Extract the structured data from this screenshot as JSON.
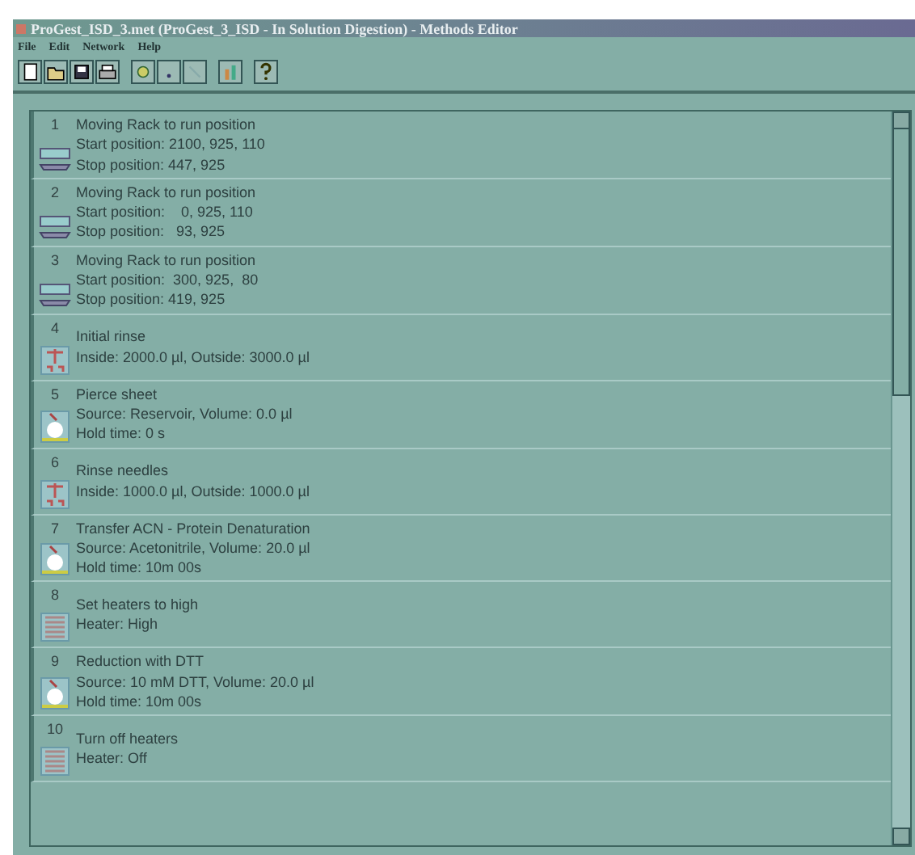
{
  "window": {
    "title": "ProGest_ISD_3.met (ProGest_3_ISD - In Solution Digestion) - Methods Editor"
  },
  "menu": [
    "File",
    "Edit",
    "Network",
    "Help"
  ],
  "steps": [
    {
      "number": "1",
      "kind": "rack",
      "lines": [
        "Moving Rack to run position",
        "Start position: 2100, 925, 110",
        "Stop position: 447, 925"
      ]
    },
    {
      "number": "2",
      "kind": "rack",
      "lines": [
        "Moving Rack to run position",
        "Start position:    0, 925, 110",
        "Stop position:   93, 925"
      ]
    },
    {
      "number": "3",
      "kind": "rack",
      "lines": [
        "Moving Rack to run position",
        "Start position:  300, 925,  80",
        "Stop position: 419, 925"
      ]
    },
    {
      "number": "4",
      "kind": "rinse",
      "lines": [
        "Initial rinse",
        "Inside: 2000.0 µl, Outside: 3000.0 µl"
      ]
    },
    {
      "number": "5",
      "kind": "dispense",
      "lines": [
        "Pierce sheet",
        "Source: Reservoir, Volume: 0.0 µl",
        "Hold time: 0 s"
      ]
    },
    {
      "number": "6",
      "kind": "rinse",
      "lines": [
        "Rinse needles",
        "Inside: 1000.0 µl, Outside: 1000.0 µl"
      ]
    },
    {
      "number": "7",
      "kind": "dispense",
      "lines": [
        "Transfer ACN - Protein Denaturation",
        "Source: Acetonitrile, Volume: 20.0 µl",
        "Hold time: 10m 00s"
      ]
    },
    {
      "number": "8",
      "kind": "heater",
      "lines": [
        "Set heaters to high",
        "Heater: High"
      ]
    },
    {
      "number": "9",
      "kind": "dispense",
      "lines": [
        "Reduction with DTT",
        "Source: 10 mM DTT, Volume: 20.0 µl",
        "Hold time: 10m 00s"
      ]
    },
    {
      "number": "10",
      "kind": "heater",
      "lines": [
        "Turn off heaters",
        "Heater: Off"
      ]
    }
  ]
}
